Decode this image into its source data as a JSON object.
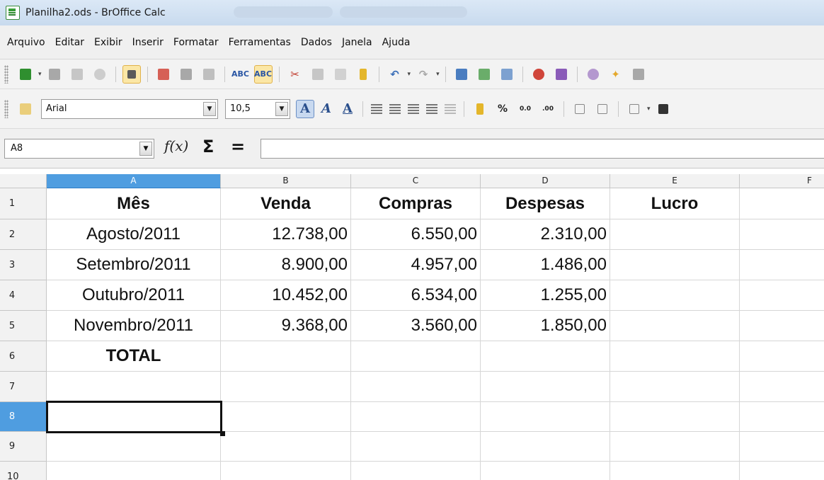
{
  "window": {
    "title": "Planilha2.ods - BrOffice Calc"
  },
  "menu": [
    "Arquivo",
    "Editar",
    "Exibir",
    "Inserir",
    "Formatar",
    "Ferramentas",
    "Dados",
    "Janela",
    "Ajuda"
  ],
  "formatting": {
    "font_name": "Arial",
    "font_size": "10,5",
    "percent_symbol": "%"
  },
  "formula_bar": {
    "cell_reference": "A8",
    "function_wizard": "f(x)",
    "sum_symbol": "Σ",
    "equals_symbol": "=",
    "content": ""
  },
  "columns": [
    "A",
    "B",
    "C",
    "D",
    "E",
    "F"
  ],
  "rows": [
    "1",
    "2",
    "3",
    "4",
    "5",
    "6",
    "7",
    "8",
    "9",
    "10"
  ],
  "sheet": {
    "headers": [
      "Mês",
      "Venda",
      "Compras",
      "Despesas",
      "Lucro"
    ],
    "data": [
      [
        "Agosto/2011",
        "12.738,00",
        "6.550,00",
        "2.310,00"
      ],
      [
        "Setembro/2011",
        "8.900,00",
        "4.957,00",
        "1.486,00"
      ],
      [
        "Outubro/2011",
        "10.452,00",
        "6.534,00",
        "1.255,00"
      ],
      [
        "Novembro/2011",
        "9.368,00",
        "3.560,00",
        "1.850,00"
      ]
    ],
    "total_label": "TOTAL"
  },
  "selection": {
    "active_cell": "A8",
    "active_column": "A",
    "active_row": "8"
  }
}
